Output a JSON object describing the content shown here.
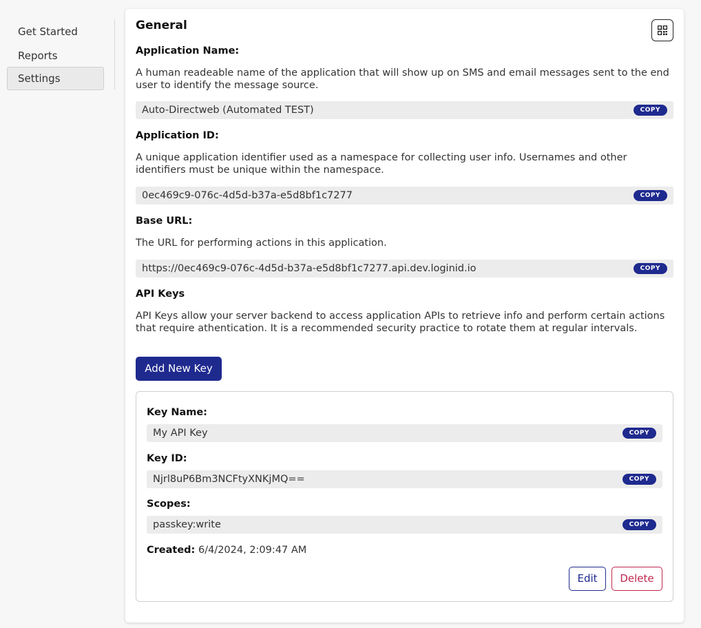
{
  "sidebar": {
    "items": [
      {
        "label": "Get Started"
      },
      {
        "label": "Reports"
      },
      {
        "label": "Settings"
      }
    ]
  },
  "general": {
    "title": "General",
    "qr_icon": "qr-code-icon"
  },
  "app_name": {
    "label": "Application Name:",
    "description": "A human readeable name of the application that will show up on SMS and email messages sent to the end user to identify the message source.",
    "value": "Auto-Directweb (Automated TEST)",
    "copy_label": "COPY"
  },
  "app_id": {
    "label": "Application ID:",
    "description": "A unique application identifier used as a namespace for collecting user info. Usernames and other identifiers must be unique within the namespace.",
    "value": "0ec469c9-076c-4d5d-b37a-e5d8bf1c7277",
    "copy_label": "COPY"
  },
  "base_url": {
    "label": "Base URL:",
    "description": "The URL for performing actions in this application.",
    "value": "https://0ec469c9-076c-4d5d-b37a-e5d8bf1c7277.api.dev.loginid.io",
    "copy_label": "COPY"
  },
  "api_keys": {
    "title": "API Keys",
    "description": "API Keys allow your server backend to access application APIs to retrieve info and perform certain actions that require athentication. It is a recommended security practice to rotate them at regular intervals.",
    "add_button": "Add New Key",
    "key": {
      "name_label": "Key Name:",
      "name_value": "My API Key",
      "id_label": "Key ID:",
      "id_value": "Njrl8uP6Bm3NCFtyXNKjMQ==",
      "scopes_label": "Scopes:",
      "scopes_value": "passkey:write",
      "created_label": "Created:",
      "created_value": "6/4/2024, 2:09:47 AM",
      "copy_label": "COPY",
      "edit_label": "Edit",
      "delete_label": "Delete"
    }
  },
  "colors": {
    "primary": "#1f2a8f",
    "danger": "#c2264f",
    "field_bg": "#ececec"
  }
}
